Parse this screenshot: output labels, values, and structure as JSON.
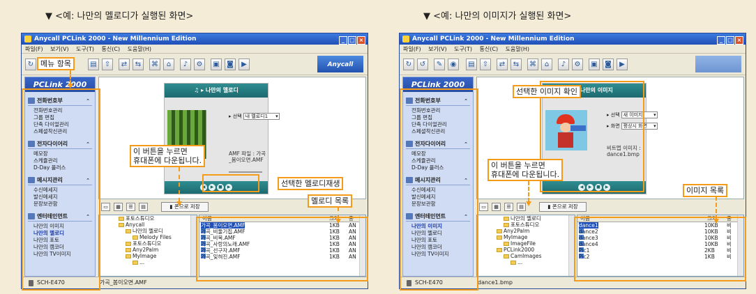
{
  "panels": [
    {
      "heading": "▼ <예: 나만의 멜로디가 실행된 화면>",
      "window": {
        "title": "Anycall PCLink 2000 - New Millennium Edition",
        "menu": [
          "파일(F)",
          "보기(V)",
          "도구(T)",
          "통신(C)",
          "도움말(H)"
        ],
        "brand": "Anycall",
        "sidebar_title": "PCLink 2000",
        "sections": [
          {
            "title": "전화번호부",
            "items": [
              "전화번호관리",
              "그룹 편집",
              "단축 다이얼관리",
              "스페셜착신관리"
            ]
          },
          {
            "title": "전자다이어리",
            "items": [
              "메모장",
              "스케쥴관리",
              "D-Day 플러스"
            ]
          },
          {
            "title": "메시지관리",
            "items": [
              "수신메세지",
              "발신메세지",
              "문장보관함"
            ]
          },
          {
            "title": "엔터테인먼트",
            "items": [
              "나만의 이미지",
              "나만의 멜로디",
              "나만의 포토",
              "나만의 캠코더",
              "나만의 TV이미지"
            ],
            "selected": 1
          }
        ],
        "player": {
          "header": "나만의 멜로디",
          "select_label": "선택",
          "select_value": "내 멜로디1",
          "info": "AMF 파일 : 가곡_봄이오면.AMF"
        },
        "save_button": "폰으로 저장",
        "tree": [
          "포토스튜디오",
          "Anycall",
          "나만의 멜로디",
          "Melody Files",
          "포토스튜디오",
          "Any2Palm",
          "MyImage",
          "..."
        ],
        "file_columns": [
          "이름",
          "크기",
          "종"
        ],
        "files": [
          {
            "name": "가곡_봄이오면.AMF",
            "size": "1KB",
            "type": "AN",
            "selected": true
          },
          {
            "name": "가곡_비둘기집.AMF",
            "size": "1KB",
            "type": "AN"
          },
          {
            "name": "가곡_비목.AMF",
            "size": "1KB",
            "type": "AN"
          },
          {
            "name": "가곡_사랑의노래.AMF",
            "size": "1KB",
            "type": "AN"
          },
          {
            "name": "가곡_선구자.AMF",
            "size": "1KB",
            "type": "AN"
          },
          {
            "name": "가곡_잊혀진.AMF",
            "size": "1KB",
            "type": "AN"
          }
        ],
        "status_device": "SCH-E470",
        "status_file": "가곡_봄이오면.AMF"
      },
      "callouts": {
        "menu": "메뉴 항목",
        "button": "이 버튼을 누르면\n휴대폰에 다운됩니다.",
        "play": "선택한 멜로디재생",
        "list": "멜로디 목록"
      }
    },
    {
      "heading": "▼ <예: 나만의 이미지가 실행된 화면>",
      "window": {
        "title": "Anycall PCLink 2000 - New Millennium Edition",
        "menu": [
          "파일(F)",
          "보기(V)",
          "도구(T)",
          "통신(C)",
          "도움말(H)"
        ],
        "brand": "",
        "sidebar_title": "PCLink 2000",
        "sections": [
          {
            "title": "전화번호부",
            "items": [
              "전화번호관리",
              "그룹 편집",
              "단축 다이얼관리",
              "스페셜착신관리"
            ]
          },
          {
            "title": "전자다이어리",
            "items": [
              "메모장",
              "스케쥴관리",
              "D-Day 플러스"
            ]
          },
          {
            "title": "메시지관리",
            "items": [
              "수신메세지",
              "발신메세지",
              "문장보관함"
            ]
          },
          {
            "title": "엔터테인먼트",
            "items": [
              "나만의 이미지",
              "나만의 멜로디",
              "나만의 포토",
              "나만의 캠코더",
              "나만의 TV이미지"
            ],
            "selected": 0
          }
        ],
        "player": {
          "header": "나만의 이미지",
          "select_label": "선택",
          "select_value": "새 이미지",
          "screen_label": "화면",
          "screen_value": "평상시 화면",
          "info": "비트맵 이미지 : dance1.bmp"
        },
        "save_button": "폰으로 저장",
        "tree": [
          "나만의 멜로디",
          "포토스튜디오",
          "Any2Palm",
          "MyImage",
          "ImageFile",
          "PCLink2000",
          "CamImages",
          "..."
        ],
        "file_columns": [
          "이름",
          "크기",
          "종"
        ],
        "files": [
          {
            "name": "dance1",
            "size": "10KB",
            "type": "비",
            "selected": true
          },
          {
            "name": "dance2",
            "size": "10KB",
            "type": "비"
          },
          {
            "name": "dance3",
            "size": "10KB",
            "type": "비"
          },
          {
            "name": "dance4",
            "size": "10KB",
            "type": "비"
          },
          {
            "name": "Pic1",
            "size": "2KB",
            "type": "비"
          },
          {
            "name": "Pic2",
            "size": "1KB",
            "type": "비"
          }
        ],
        "status_device": "SCH-E470",
        "status_file": "dance1.bmp"
      },
      "callouts": {
        "confirm": "선택한 이미지 확인",
        "button": "이 버튼을 누르면\n휴대폰에 다운됩니다.",
        "list": "이미지 목록"
      }
    }
  ]
}
